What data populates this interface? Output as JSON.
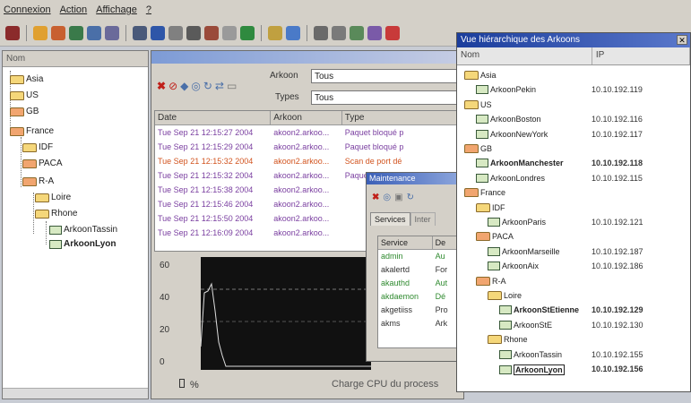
{
  "menu": [
    "Connexion",
    "Action",
    "Affichage",
    "?"
  ],
  "left_panel": {
    "header": "Nom",
    "tree": [
      {
        "label": "Asia",
        "color": "yellow"
      },
      {
        "label": "US",
        "color": "yellow"
      },
      {
        "label": "GB",
        "color": "orange"
      },
      {
        "label": "France",
        "color": "orange"
      },
      {
        "label": "IDF",
        "color": "yellow"
      },
      {
        "label": "PACA",
        "color": "orange"
      },
      {
        "label": "R-A",
        "color": "orange"
      },
      {
        "label": "Loire",
        "color": "yellow"
      },
      {
        "label": "Rhone",
        "color": "yellow"
      },
      {
        "label": "ArkoonTassin",
        "color": "leaf"
      },
      {
        "label": "ArkoonLyon",
        "color": "leaf"
      }
    ]
  },
  "mid_window": {
    "filter": {
      "arkoon_label": "Arkoon",
      "arkoon_value": "Tous",
      "types_label": "Types",
      "types_value": "Tous"
    },
    "columns": [
      "Date",
      "Arkoon",
      "Type"
    ],
    "rows": [
      {
        "date": "Tue Sep 21 12:15:27 2004",
        "arkoon": "akoon2.arkoo...",
        "type": "Paquet bloqué p",
        "color": "#7a3fa0"
      },
      {
        "date": "Tue Sep 21 12:15:29 2004",
        "arkoon": "akoon2.arkoo...",
        "type": "Paquet bloqué p",
        "color": "#7a3fa0"
      },
      {
        "date": "Tue Sep 21 12:15:32 2004",
        "arkoon": "akoon2.arkoo...",
        "type": "Scan de port dé",
        "color": "#d2541f"
      },
      {
        "date": "Tue Sep 21 12:15:32 2004",
        "arkoon": "akoon2.arkoo...",
        "type": "Paquet bloqué p",
        "color": "#7a3fa0"
      },
      {
        "date": "Tue Sep 21 12:15:38 2004",
        "arkoon": "akoon2.arkoo...",
        "type": "",
        "color": "#7a3fa0"
      },
      {
        "date": "Tue Sep 21 12:15:46 2004",
        "arkoon": "akoon2.arkoo...",
        "type": "",
        "color": "#7a3fa0"
      },
      {
        "date": "Tue Sep 21 12:15:50 2004",
        "arkoon": "akoon2.arkoo...",
        "type": "",
        "color": "#7a3fa0"
      },
      {
        "date": "Tue Sep 21 12:16:09 2004",
        "arkoon": "akoon2.arkoo...",
        "type": "",
        "color": "#7a3fa0"
      }
    ],
    "chart": {
      "yticks": [
        "60",
        "40",
        "20",
        "0"
      ],
      "unit": "%",
      "caption": "Charge CPU du process"
    }
  },
  "maintenance": {
    "title": "Maintenance",
    "tabs": [
      "Services",
      "Inter"
    ],
    "columns": [
      "Service",
      "De"
    ],
    "rows": [
      {
        "name": "admin",
        "desc": "Au",
        "color": "#2f8a2f"
      },
      {
        "name": "akalertd",
        "desc": "For",
        "color": "#333"
      },
      {
        "name": "akauthd",
        "desc": "Aut",
        "color": "#2f8a2f"
      },
      {
        "name": "akdaemon",
        "desc": "Dé",
        "color": "#2f8a2f"
      },
      {
        "name": "akgetiiss",
        "desc": "Pro",
        "color": "#333"
      },
      {
        "name": "akms",
        "desc": "Ark",
        "color": "#333"
      }
    ]
  },
  "hierarchy": {
    "title": "Vue hiérarchique des Arkoons",
    "columns": [
      "Nom",
      "IP"
    ],
    "rows": [
      {
        "label": "Asia",
        "ip": "",
        "kind": "folder-yellow",
        "level": 0,
        "bold": false
      },
      {
        "label": "ArkoonPekin",
        "ip": "10.10.192.119",
        "kind": "leaf",
        "level": 1,
        "bold": false
      },
      {
        "label": "US",
        "ip": "",
        "kind": "folder-yellow",
        "level": 0,
        "bold": false
      },
      {
        "label": "ArkoonBoston",
        "ip": "10.10.192.116",
        "kind": "leaf",
        "level": 1,
        "bold": false
      },
      {
        "label": "ArkoonNewYork",
        "ip": "10.10.192.117",
        "kind": "leaf",
        "level": 1,
        "bold": false
      },
      {
        "label": "GB",
        "ip": "",
        "kind": "folder-orange",
        "level": 0,
        "bold": false
      },
      {
        "label": "ArkoonManchester",
        "ip": "10.10.192.118",
        "kind": "leaf",
        "level": 1,
        "bold": true
      },
      {
        "label": "ArkoonLondres",
        "ip": "10.10.192.115",
        "kind": "leaf",
        "level": 1,
        "bold": false
      },
      {
        "label": "France",
        "ip": "",
        "kind": "folder-orange",
        "level": 0,
        "bold": false
      },
      {
        "label": "IDF",
        "ip": "",
        "kind": "folder-yellow",
        "level": 1,
        "bold": false
      },
      {
        "label": "ArkoonParis",
        "ip": "10.10.192.121",
        "kind": "leaf",
        "level": 2,
        "bold": false
      },
      {
        "label": "PACA",
        "ip": "",
        "kind": "folder-orange",
        "level": 1,
        "bold": false
      },
      {
        "label": "ArkoonMarseille",
        "ip": "10.10.192.187",
        "kind": "leaf",
        "level": 2,
        "bold": false
      },
      {
        "label": "ArkoonAix",
        "ip": "10.10.192.186",
        "kind": "leaf",
        "level": 2,
        "bold": false
      },
      {
        "label": "R-A",
        "ip": "",
        "kind": "folder-orange",
        "level": 1,
        "bold": false
      },
      {
        "label": "Loire",
        "ip": "",
        "kind": "folder-yellow",
        "level": 2,
        "bold": false
      },
      {
        "label": "ArkoonStEtienne",
        "ip": "10.10.192.129",
        "kind": "leaf",
        "level": 3,
        "bold": true
      },
      {
        "label": "ArkoonStE",
        "ip": "10.10.192.130",
        "kind": "leaf",
        "level": 3,
        "bold": false
      },
      {
        "label": "Rhone",
        "ip": "",
        "kind": "folder-yellow",
        "level": 2,
        "bold": false
      },
      {
        "label": "ArkoonTassin",
        "ip": "10.10.192.155",
        "kind": "leaf",
        "level": 3,
        "bold": false
      },
      {
        "label": "ArkoonLyon",
        "ip": "10.10.192.156",
        "kind": "leaf",
        "level": 3,
        "bold": true
      }
    ]
  }
}
